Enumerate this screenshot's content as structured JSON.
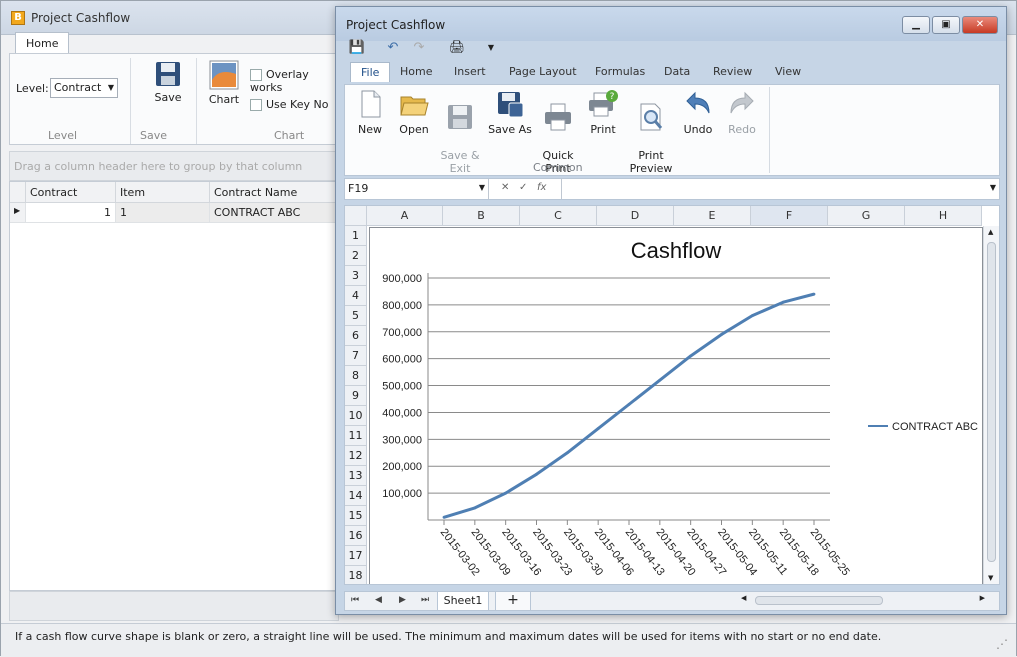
{
  "main_window": {
    "title": "Project Cashflow",
    "app_icon": "B",
    "tab_home": "Home",
    "level_label": "Level:",
    "level_value": "Contract",
    "save_label": "Save",
    "chart_label": "Chart",
    "overlay_label": "Overlay works",
    "use_key_label": "Use Key No",
    "group_level": "Level",
    "group_save": "Save",
    "group_chart": "Chart",
    "group_panel_hint": "Drag a column header here to group by that column",
    "columns": [
      "Contract",
      "Item",
      "Contract Name"
    ],
    "row": {
      "contract": "1",
      "item": "1",
      "name": "CONTRACT ABC"
    },
    "status_text": "If a cash flow curve shape is blank or zero, a straight line will be used. The minimum and maximum dates will be used for items with no start or no end date."
  },
  "sheet_window": {
    "title": "Project Cashflow",
    "tabs": [
      "File",
      "Home",
      "Insert",
      "Page Layout",
      "Formulas",
      "Data",
      "Review",
      "View"
    ],
    "ribbon_buttons": [
      {
        "label": "New",
        "icon": "new-doc-icon",
        "enabled": true
      },
      {
        "label": "Open",
        "icon": "folder-open-icon",
        "enabled": true
      },
      {
        "label": "Save &\nExit",
        "icon": "save-disk-icon",
        "enabled": false
      },
      {
        "label": "Save As",
        "icon": "save-as-icon",
        "enabled": true
      },
      {
        "label": "Quick\nPrint",
        "icon": "quick-print-icon",
        "enabled": true
      },
      {
        "label": "Print",
        "icon": "print-icon",
        "enabled": true
      },
      {
        "label": "Print\nPreview",
        "icon": "print-preview-icon",
        "enabled": true
      },
      {
        "label": "Undo",
        "icon": "undo-icon",
        "enabled": true
      },
      {
        "label": "Redo",
        "icon": "redo-icon",
        "enabled": false
      }
    ],
    "ribbon_group": "Common",
    "name_box": "F19",
    "column_headers": [
      "A",
      "B",
      "C",
      "D",
      "E",
      "F",
      "G",
      "H"
    ],
    "row_headers": [
      "1",
      "2",
      "3",
      "4",
      "5",
      "6",
      "7",
      "8",
      "9",
      "10",
      "11",
      "12",
      "13",
      "14",
      "15",
      "16",
      "17",
      "18"
    ],
    "sheet_tab": "Sheet1",
    "add_sheet": "+"
  },
  "chart_data": {
    "type": "line",
    "title": "Cashflow",
    "x": [
      "2015-03-02",
      "2015-03-09",
      "2015-03-16",
      "2015-03-23",
      "2015-03-30",
      "2015-04-06",
      "2015-04-13",
      "2015-04-20",
      "2015-04-27",
      "2015-05-04",
      "2015-05-11",
      "2015-05-18",
      "2015-05-25"
    ],
    "series": [
      {
        "name": "CONTRACT ABC",
        "values": [
          10000,
          45000,
          100000,
          170000,
          250000,
          340000,
          430000,
          520000,
          610000,
          690000,
          760000,
          810000,
          840000
        ],
        "color": "#4f7fb3"
      }
    ],
    "yticks": [
      "100,000",
      "200,000",
      "300,000",
      "400,000",
      "500,000",
      "600,000",
      "700,000",
      "800,000",
      "900,000"
    ],
    "ylim": [
      0,
      900000
    ],
    "grid": true,
    "legend": "right"
  }
}
